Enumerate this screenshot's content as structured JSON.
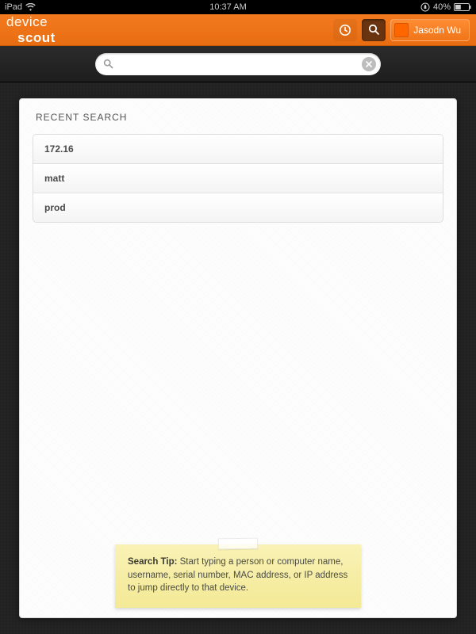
{
  "status_bar": {
    "device": "iPad",
    "time": "10:37 AM",
    "battery_pct": "40%"
  },
  "header": {
    "brand_light": "device",
    "brand_bold": "scout",
    "user_name": "Jasodn Wu"
  },
  "search": {
    "placeholder": "",
    "value": ""
  },
  "recent": {
    "title": "RECENT SEARCH",
    "items": [
      "172.16",
      "matt",
      "prod"
    ]
  },
  "tip": {
    "label": "Search Tip:",
    "body": " Start typing a person or computer name, username, serial number, MAC address, or IP address to jump directly to that device."
  },
  "colors": {
    "accent": "#ee7321",
    "note": "#f6eea5"
  }
}
